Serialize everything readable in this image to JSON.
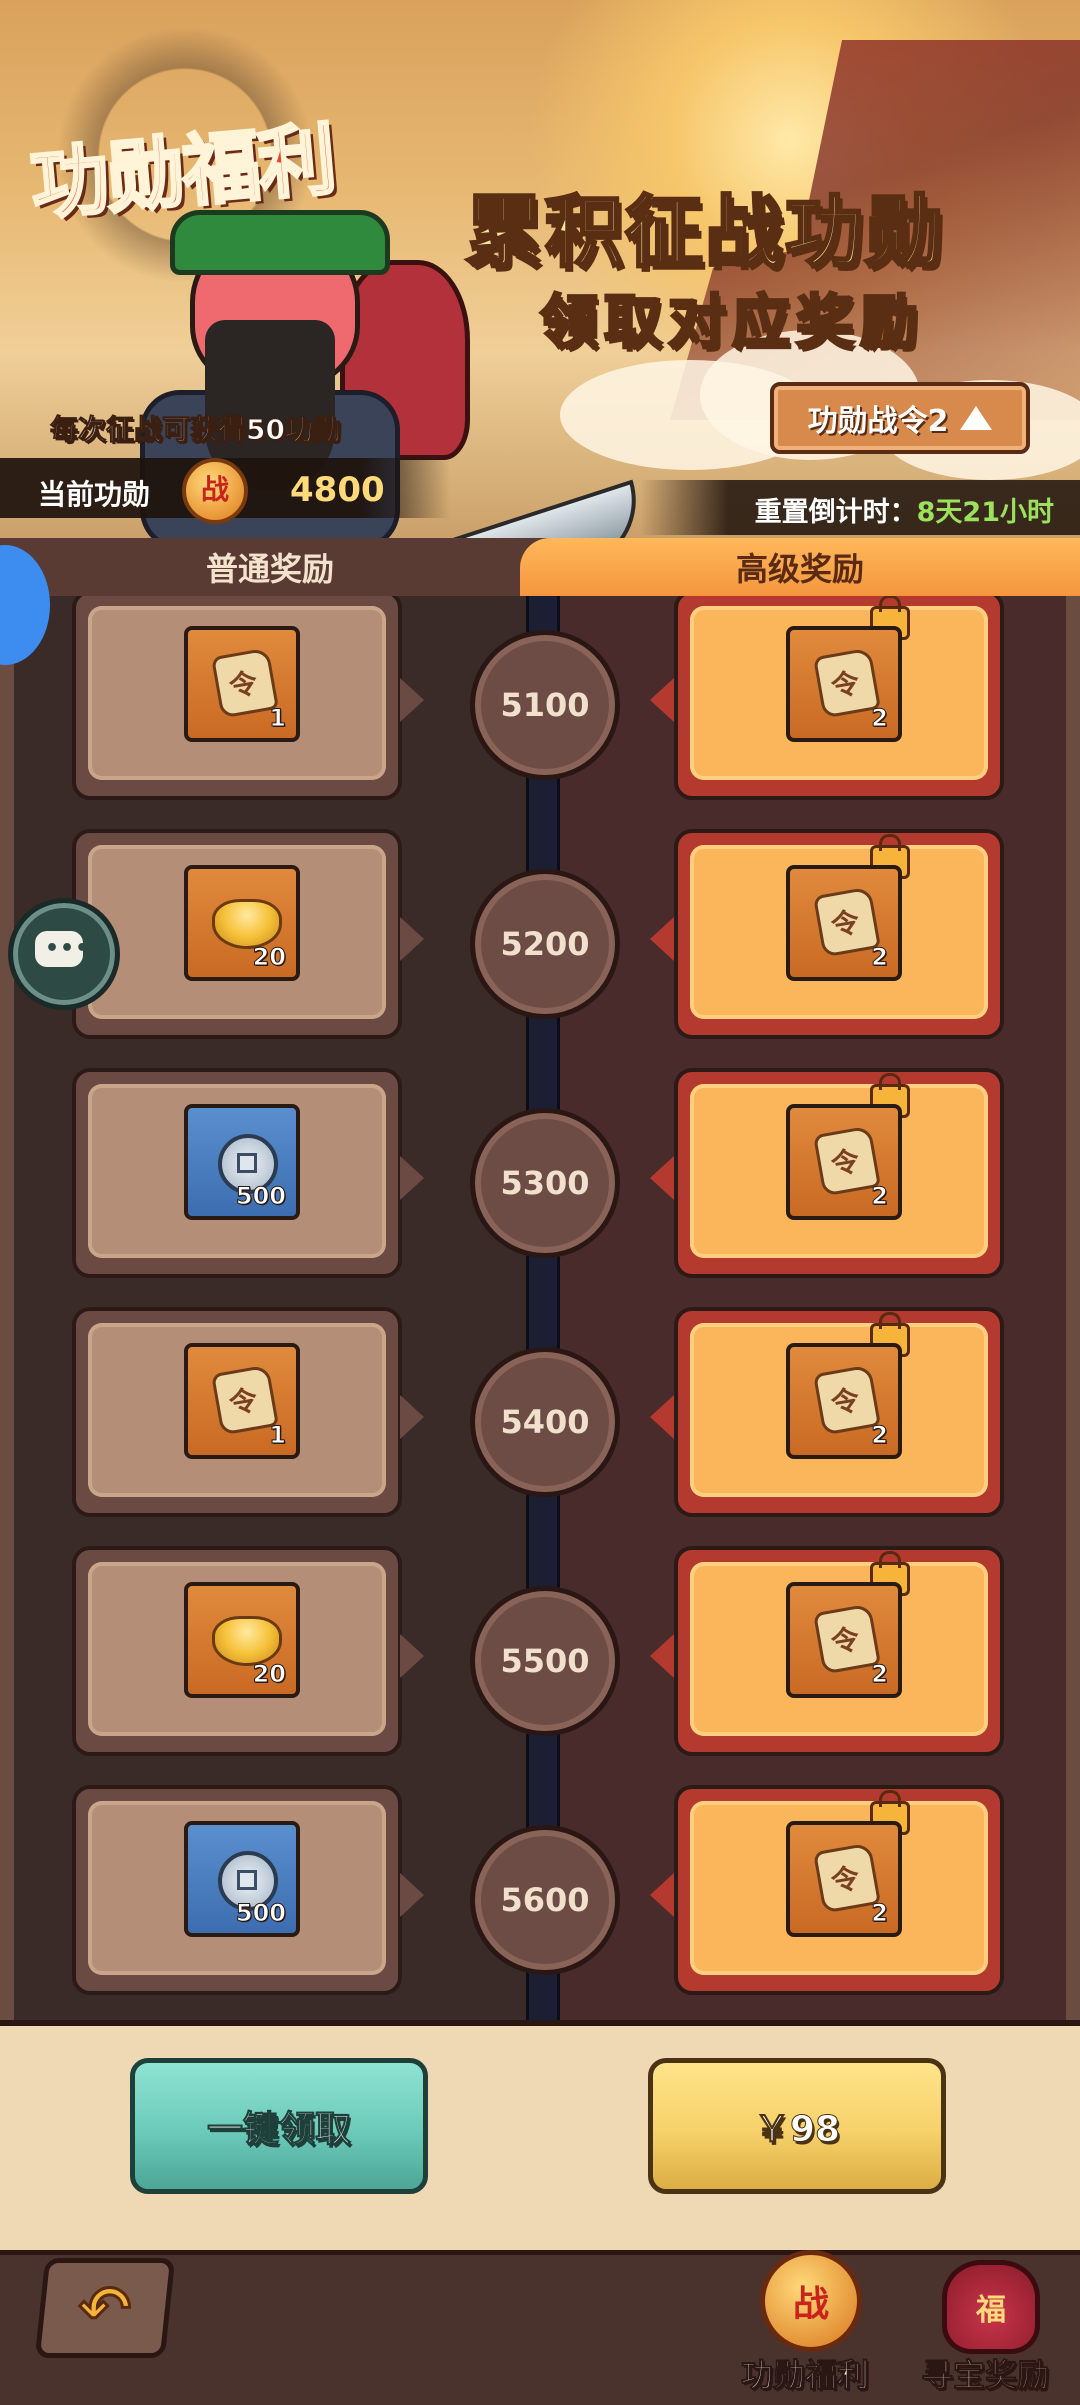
{
  "banner": {
    "title": "功勋福利",
    "headline": "累积征战功勋",
    "subheadline": "领取对应奖励",
    "info": "每次征战可获得50功勋",
    "merit_label": "当前功勋",
    "merit_coin_glyph": "战",
    "merit_value": "4800",
    "pass_button_label": "功勋战令2",
    "countdown_label": "重置倒计时：",
    "countdown_value": "8天21小时"
  },
  "tabs": {
    "normal": "普通奖励",
    "premium": "高级奖励",
    "active": "premium"
  },
  "rewards": [
    {
      "milestone": "5100",
      "normal": {
        "icon": "token-scroll-icon",
        "qty": "1"
      },
      "premium": {
        "icon": "token-scroll-icon",
        "qty": "2"
      }
    },
    {
      "milestone": "5200",
      "normal": {
        "icon": "gold-ingot-icon",
        "qty": "20"
      },
      "premium": {
        "icon": "token-scroll-icon",
        "qty": "2"
      }
    },
    {
      "milestone": "5300",
      "normal": {
        "icon": "copper-coin-icon",
        "qty": "500"
      },
      "premium": {
        "icon": "token-scroll-icon",
        "qty": "2"
      }
    },
    {
      "milestone": "5400",
      "normal": {
        "icon": "token-scroll-icon",
        "qty": "1"
      },
      "premium": {
        "icon": "token-scroll-icon",
        "qty": "2"
      }
    },
    {
      "milestone": "5500",
      "normal": {
        "icon": "gold-ingot-icon",
        "qty": "20"
      },
      "premium": {
        "icon": "token-scroll-icon",
        "qty": "2"
      }
    },
    {
      "milestone": "5600",
      "normal": {
        "icon": "copper-coin-icon",
        "qty": "500"
      },
      "premium": {
        "icon": "token-scroll-icon",
        "qty": "2"
      }
    }
  ],
  "actions": {
    "claim_all": "一键领取",
    "price": "￥98"
  },
  "bottom_nav": {
    "back_icon": "back-arrow-icon",
    "items": [
      {
        "label": "功勋福利",
        "glyph": "战",
        "active": true
      },
      {
        "label": "寻宝奖励",
        "glyph": "福",
        "active": false
      }
    ]
  },
  "colors": {
    "premium_card": "#fbb55a",
    "normal_card": "#b48e76",
    "claim_button": "#6bcab9",
    "price_button": "#f6d16a",
    "countdown_value": "#9be15d"
  }
}
